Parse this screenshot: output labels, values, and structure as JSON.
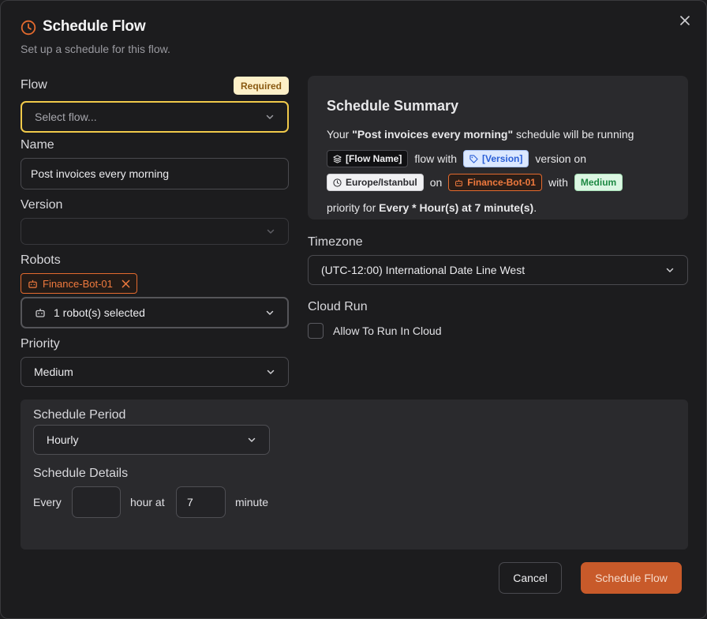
{
  "dialog": {
    "title": "Schedule Flow",
    "subtitle": "Set up a schedule for this flow."
  },
  "form": {
    "flow_label": "Flow",
    "required_badge": "Required",
    "flow_placeholder": "Select flow...",
    "name_label": "Name",
    "name_value": "Post invoices every morning",
    "version_label": "Version",
    "version_value": "",
    "robots_label": "Robots",
    "robot_chip": "Finance-Bot-01",
    "robots_selected": "1 robot(s) selected",
    "priority_label": "Priority",
    "priority_value": "Medium"
  },
  "summary": {
    "title": "Schedule Summary",
    "line1_prefix": "Your ",
    "schedule_name": "\"Post invoices every morning\"",
    "line1_suffix": " schedule will be running",
    "flow_tag": "[Flow Name]",
    "flow_with": "flow with",
    "version_tag": "[Version]",
    "version_on": "version on",
    "timezone_tag": "Europe/Istanbul",
    "on_text": "on",
    "robot_tag": "Finance-Bot-01",
    "with_text": "with",
    "priority_tag": "Medium",
    "priority_for": "priority for ",
    "frequency": "Every * Hour(s) at 7 minute(s)",
    "period": "."
  },
  "timezone": {
    "label": "Timezone",
    "value": "(UTC-12:00) International Date Line West"
  },
  "cloud": {
    "label": "Cloud Run",
    "checkbox_label": "Allow To Run In Cloud",
    "checked": false
  },
  "schedule": {
    "period_label": "Schedule Period",
    "period_value": "Hourly",
    "details_label": "Schedule Details",
    "every_text": "Every",
    "hour_value": "",
    "hour_at_text": "hour at",
    "minute_value": "7",
    "minute_text": "minute"
  },
  "actions": {
    "cancel": "Cancel",
    "submit": "Schedule Flow"
  },
  "colors": {
    "accent": "#e36a2e",
    "focus": "#f0c94a",
    "primary_button": "#c85a2a"
  }
}
